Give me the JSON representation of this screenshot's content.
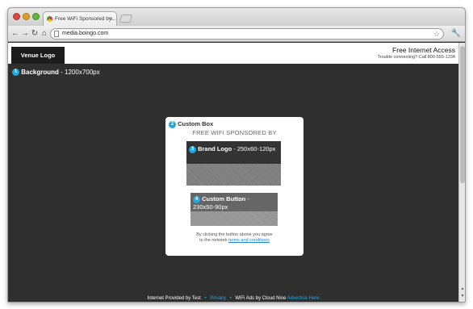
{
  "browser": {
    "tab_title": "Free WiFi Sponsored by...",
    "url": "media.boingo.com"
  },
  "icons": [
    "close-icon",
    "back-icon",
    "forward-icon",
    "reload-icon",
    "home-icon",
    "star-icon",
    "wrench-icon"
  ],
  "header": {
    "venue_logo": "Venue Logo",
    "title": "Free Internet Access",
    "trouble": "Trouble connecting? Call 800-555-1234"
  },
  "background": {
    "number": "1",
    "label": "Background",
    "size": " - 1200x700px"
  },
  "custom_box": {
    "number": "2",
    "label": "Custom Box",
    "sponsored": "FREE WIFI SPONSORED BY",
    "brand_logo": {
      "number": "3",
      "label": "Brand Logo",
      "size": " - 250x60-120px"
    },
    "custom_button": {
      "number": "4",
      "label": "Custom Button",
      "size1": " -",
      "size2": "230x50-90px"
    },
    "note_line1": "By clicking the button above you agree",
    "note_line2": "to the network ",
    "terms_link": "terms and conditions"
  },
  "footer": {
    "provided": "Internet Provided by Test",
    "privacy": "Privacy",
    "wifi_ads": "WiFi Ads by Cloud Nine",
    "advertise": "Advertise Here"
  },
  "colors": {
    "accent": "#22a7e0",
    "page_bg": "#2f2f2f"
  }
}
